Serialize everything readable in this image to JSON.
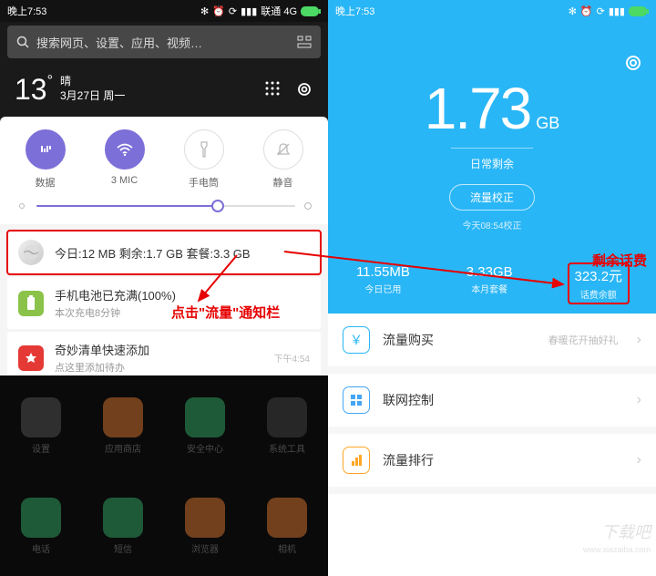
{
  "left": {
    "status": {
      "time": "晚上7:53",
      "carrier": "联通 4G"
    },
    "search_placeholder": "搜索网页、设置、应用、视频…",
    "weather": {
      "temp": "13",
      "cond": "晴",
      "date": "3月27日 周一"
    },
    "toggles": [
      {
        "name": "data",
        "label": "数据",
        "active": true
      },
      {
        "name": "wifi",
        "label": "3 MIC",
        "active": true
      },
      {
        "name": "torch",
        "label": "手电筒",
        "active": false
      },
      {
        "name": "silent",
        "label": "静音",
        "active": false
      }
    ],
    "notifications": [
      {
        "id": "traffic",
        "title": "今日:12 MB  剩余:1.7 GB  套餐:3.3 GB",
        "sub": "",
        "time": "",
        "color": "#e8e8e8",
        "highlight": true
      },
      {
        "id": "battery",
        "title": "手机电池已充满(100%)",
        "sub": "本次充电8分钟",
        "time": "",
        "color": "#8bc34a"
      },
      {
        "id": "wunderlist",
        "title": "奇妙清单快速添加",
        "sub": "点这里添加待办",
        "time": "下午4:54",
        "color": "#e53935"
      }
    ],
    "apps_row1": [
      "设置",
      "应用商店",
      "安全中心",
      "系统工具"
    ],
    "apps_row2": [
      "电话",
      "短信",
      "浏览器",
      "相机"
    ],
    "annotation_notif": "点击\"流量\"通知栏"
  },
  "right": {
    "status": {
      "time": "晚上7:53"
    },
    "data_remaining": {
      "value": "1.73",
      "unit": "GB",
      "label": "日常剩余"
    },
    "correct_btn": "流量校正",
    "last_update": "今天08:54校正",
    "stats": [
      {
        "val": "11.55MB",
        "lbl": "今日已用"
      },
      {
        "val": "3.33GB",
        "lbl": "本月套餐"
      },
      {
        "val": "323.2元",
        "lbl": "话费余额",
        "highlight": true
      }
    ],
    "annotation_balance": "剩余话费",
    "menu": [
      {
        "id": "buy",
        "label": "流量购买",
        "extra": "春暖花开抽好礼",
        "color": "#29b6f6",
        "icon": "¥"
      },
      {
        "id": "net-control",
        "label": "联网控制",
        "extra": "",
        "color": "#42a5f5",
        "icon": "⊞"
      },
      {
        "id": "rank",
        "label": "流量排行",
        "extra": "",
        "color": "#ffa726",
        "icon": "▮"
      }
    ]
  },
  "watermark": "下载吧",
  "watermark_url": "www.xiazaiba.com"
}
